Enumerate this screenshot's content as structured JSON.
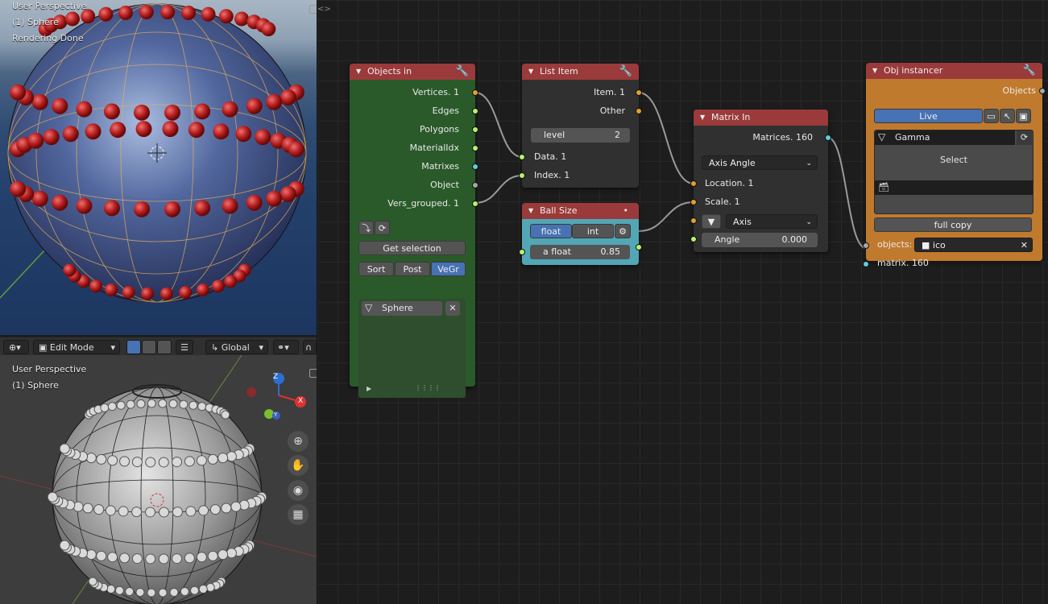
{
  "render_view": {
    "line1": "User Perspective",
    "line2": "(1) Sphere",
    "line3": "Rendering Done"
  },
  "edit_header": {
    "mode": "Edit Mode",
    "orientation": "Global"
  },
  "edit_view": {
    "line1": "User Perspective",
    "line2": "(1) Sphere",
    "gizmo_z": "Z",
    "gizmo_x": "X",
    "gizmo_y": "Y"
  },
  "nodes": {
    "objects_in": {
      "title": "Objects in",
      "outputs": [
        "Vertices. 1",
        "Edges",
        "Polygons",
        "MaterialIdx",
        "Matrixes",
        "Object",
        "Vers_grouped. 1"
      ],
      "get_selection": "Get selection",
      "sort": "Sort",
      "post": "Post",
      "vegr": "VeGr",
      "item": "Sphere"
    },
    "list_item": {
      "title": "List Item",
      "out_item": "Item. 1",
      "out_other": "Other",
      "level_label": "level",
      "level_value": "2",
      "in_data": "Data. 1",
      "in_index": "Index. 1"
    },
    "ball_size": {
      "title": "Ball Size",
      "float_btn": "float",
      "int_btn": "int",
      "field_label": "a float",
      "field_value": "0.85"
    },
    "matrix_in": {
      "title": "Matrix In",
      "out_matrices": "Matrices. 160",
      "mode": "Axis Angle",
      "in_location": "Location. 1",
      "in_scale": "Scale. 1",
      "axis": "Axis",
      "angle_label": "Angle",
      "angle_value": "0.000"
    },
    "obj_instancer": {
      "title": "Obj instancer",
      "out_objects": "Objects",
      "live": "Live",
      "mesh": "Gamma",
      "select": "Select",
      "full_copy": "full copy",
      "objects_label": "objects:",
      "objects_value": "ico",
      "in_matrix": "matrix. 160"
    }
  },
  "colors": {
    "node_header": "#9b3a3a",
    "objects_in_body": "#2a5a2a",
    "ball_size_body": "#52a6b5",
    "obj_instancer_body": "#c07a2e",
    "default_body": "#303030",
    "accent_blue": "#4772b3"
  }
}
